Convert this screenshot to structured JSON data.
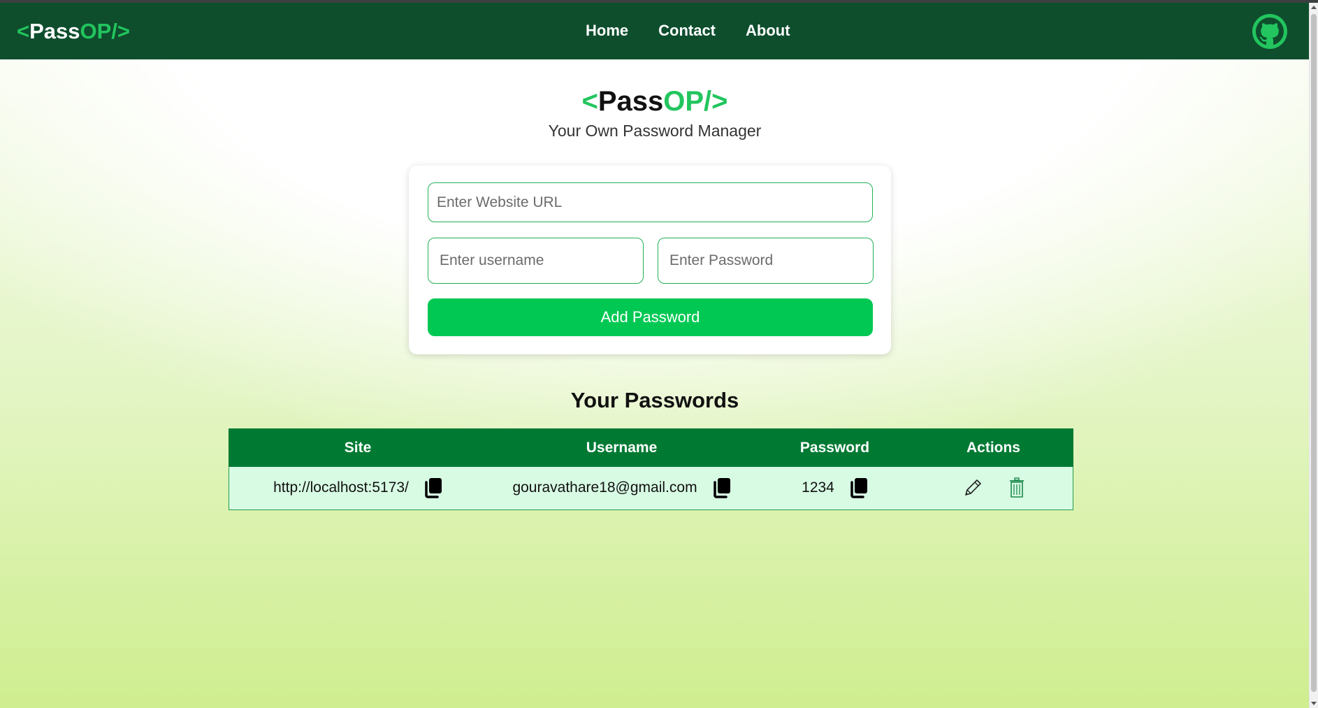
{
  "nav": {
    "logo": {
      "open": "<",
      "pass": "Pass",
      "op": "OP/",
      "close": ">"
    },
    "links": [
      "Home",
      "Contact",
      "About"
    ],
    "github_icon": "github-icon"
  },
  "hero": {
    "logo": {
      "open": "<",
      "pass": "Pass",
      "op": "OP/",
      "close": ">"
    },
    "tagline": "Your Own Password Manager"
  },
  "form": {
    "site_placeholder": "Enter Website URL",
    "username_placeholder": "Enter username",
    "password_placeholder": "Enter Password",
    "add_label": "Add Password"
  },
  "passwords": {
    "title": "Your Passwords",
    "columns": [
      "Site",
      "Username",
      "Password",
      "Actions"
    ],
    "rows": [
      {
        "site": "http://localhost:5173/",
        "username": "gouravathare18@gmail.com",
        "password": "1234"
      }
    ],
    "icons": {
      "copy": "copy-icon",
      "edit": "edit-icon",
      "delete": "delete-icon"
    }
  },
  "colors": {
    "navbar": "#0e4e2d",
    "accent": "#22c55e",
    "button": "#00c853",
    "table_header": "#007a33",
    "table_row": "#d8fbe4"
  }
}
